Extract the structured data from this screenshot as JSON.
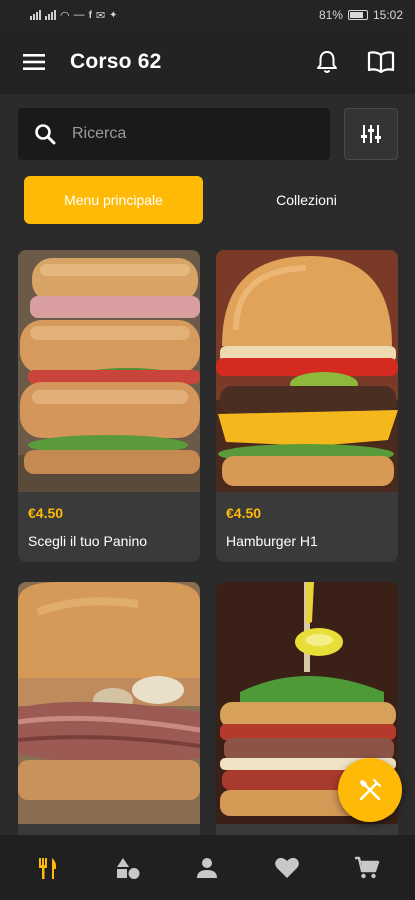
{
  "status_bar": {
    "battery": "81%",
    "time": "15:02"
  },
  "app_bar": {
    "title": "Corso 62"
  },
  "search": {
    "placeholder": "Ricerca"
  },
  "tabs": [
    {
      "label": "Menu principale",
      "active": true
    },
    {
      "label": "Collezioni",
      "active": false
    }
  ],
  "products": [
    {
      "price": "€4.50",
      "name": "Scegli il tuo Panino",
      "image": "baguette-sandwich-photo"
    },
    {
      "price": "€4.50",
      "name": "Hamburger H1",
      "image": "cheeseburger-photo"
    },
    {
      "image": "roast-beef-sandwich-photo"
    },
    {
      "image": "stacked-burger-photo"
    }
  ],
  "bottom_nav": [
    "fork-knife-icon",
    "shapes-icon",
    "person-icon",
    "heart-icon",
    "cart-icon"
  ],
  "colors": {
    "accent": "#ffba08",
    "background": "#2b2b2b",
    "bar": "#232323",
    "card": "#3a3a3a"
  }
}
